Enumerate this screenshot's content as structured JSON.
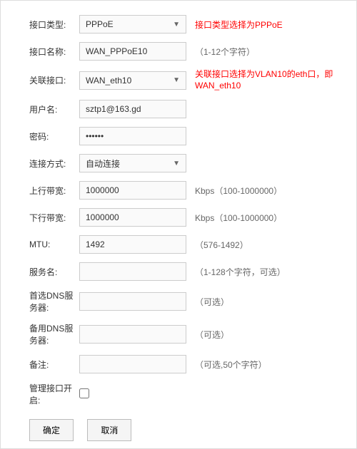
{
  "fields": {
    "type": {
      "label": "接口类型:",
      "value": "PPPoE",
      "hint": "接口类型选择为PPPoE"
    },
    "name": {
      "label": "接口名称:",
      "value": "WAN_PPPoE10",
      "hint": "（1-12个字符）"
    },
    "assoc": {
      "label": "关联接口:",
      "value": "WAN_eth10",
      "hint": "关联接口选择为VLAN10的eth口，即WAN_eth10"
    },
    "user": {
      "label": "用户名:",
      "value": "sztp1@163.gd",
      "hint": ""
    },
    "pass": {
      "label": "密码:",
      "value": "••••••",
      "hint": ""
    },
    "conn": {
      "label": "连接方式:",
      "value": "自动连接",
      "hint": ""
    },
    "up": {
      "label": "上行带宽:",
      "value": "1000000",
      "hint": "Kbps（100-1000000）"
    },
    "down": {
      "label": "下行带宽:",
      "value": "1000000",
      "hint": "Kbps（100-1000000）"
    },
    "mtu": {
      "label": "MTU:",
      "value": "1492",
      "hint": "（576-1492）"
    },
    "service": {
      "label": "服务名:",
      "value": "",
      "hint": "（1-128个字符，可选）"
    },
    "dns1": {
      "label": "首选DNS服务器:",
      "value": "",
      "hint": "（可选）"
    },
    "dns2": {
      "label": "备用DNS服务器:",
      "value": "",
      "hint": "（可选）"
    },
    "remark": {
      "label": "备注:",
      "value": "",
      "hint": "（可选,50个字符）"
    },
    "mgmt": {
      "label": "管理接口开启:",
      "checked": false
    }
  },
  "buttons": {
    "ok": "确定",
    "cancel": "取消"
  }
}
